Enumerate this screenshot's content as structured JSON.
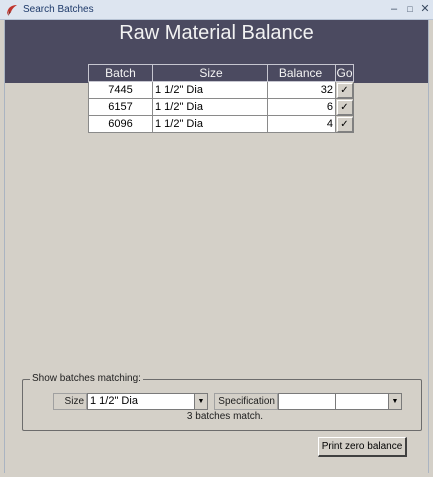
{
  "window": {
    "title": "Search Batches",
    "controls": {
      "minimize": "–",
      "maximize": "□",
      "close": "✕"
    }
  },
  "page": {
    "title": "Raw Material Balance"
  },
  "table": {
    "columns": [
      "Batch",
      "Size",
      "Balance",
      "Go"
    ],
    "rows": [
      {
        "batch": "7445",
        "size": "1 1/2\" Dia",
        "balance": "32",
        "go": "✓"
      },
      {
        "batch": "6157",
        "size": "1 1/2\" Dia",
        "balance": "6",
        "go": "✓"
      },
      {
        "batch": "6096",
        "size": "1 1/2\" Dia",
        "balance": "4",
        "go": "✓"
      }
    ]
  },
  "filter": {
    "group_label": "Show batches matching:",
    "size_label": "Size",
    "size_value": "1 1/2\" Dia",
    "spec_label": "Specification",
    "spec_value": "",
    "dropdown_arrow": "▼",
    "match_text": "3 batches match."
  },
  "actions": {
    "print_zero_label": "Print zero balance"
  },
  "colors": {
    "header_band": "#4b4a60",
    "background": "#d4d0c8"
  }
}
